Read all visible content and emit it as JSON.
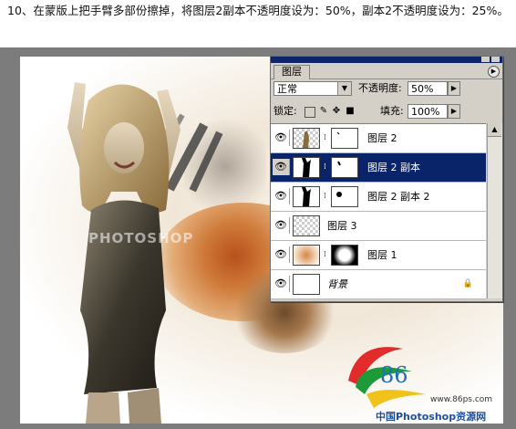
{
  "instruction": "10、在蒙版上把手臂多部份擦掉，将图层2副本不透明度设为：50%，副本2不透明度设为：25%。",
  "watermark": "PHOTOSHOP",
  "logo": {
    "number": "86",
    "url": "www.86ps.com",
    "cn_name": "中国Photoshop资源网"
  },
  "panel": {
    "tab": "图层",
    "menu_icon": "panel-menu-arrow",
    "blend_mode": "正常",
    "opacity_label": "不透明度:",
    "opacity_value": "50%",
    "lock_label": "锁定:",
    "fill_label": "填充:",
    "fill_value": "100%",
    "layers": [
      {
        "name": "图层 2",
        "visible": true,
        "selected": false,
        "has_mask": true,
        "thumb": "woman-arm-thumb"
      },
      {
        "name": "图层 2 副本",
        "visible": true,
        "selected": true,
        "has_mask": true,
        "thumb": "woman-silhouette-thumb"
      },
      {
        "name": "图层 2 副本 2",
        "visible": true,
        "selected": false,
        "has_mask": true,
        "thumb": "woman-silhouette-thumb"
      },
      {
        "name": "图层 3",
        "visible": true,
        "selected": false,
        "has_mask": false,
        "thumb": "transparent-thumb"
      },
      {
        "name": "图层 1",
        "visible": true,
        "selected": false,
        "has_mask": true,
        "thumb": "splash-thumb"
      },
      {
        "name": "背景",
        "visible": true,
        "selected": false,
        "has_mask": false,
        "thumb": "white-thumb",
        "locked": true
      }
    ]
  },
  "colors": {
    "selection": "#0a246a",
    "panel_bg": "#d4d0c8",
    "stage_bg": "#7c7c7c",
    "logo_blue": "#1e6fb8"
  }
}
